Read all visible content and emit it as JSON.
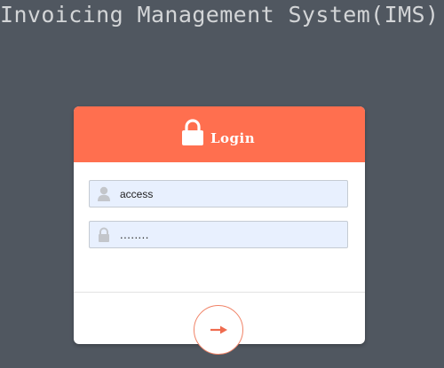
{
  "app": {
    "title": "Invoicing Management System(IMS)"
  },
  "login_card": {
    "title": "Login",
    "header_icon": "lock-icon",
    "username": {
      "icon": "user-icon",
      "value": "access"
    },
    "password": {
      "icon": "lock-icon",
      "value": "........"
    },
    "submit_icon": "arrow-right-icon"
  },
  "colors": {
    "background": "#505760",
    "accent": "#ff6f4f",
    "input_fill": "#e8f0fe",
    "card": "#ffffff"
  }
}
